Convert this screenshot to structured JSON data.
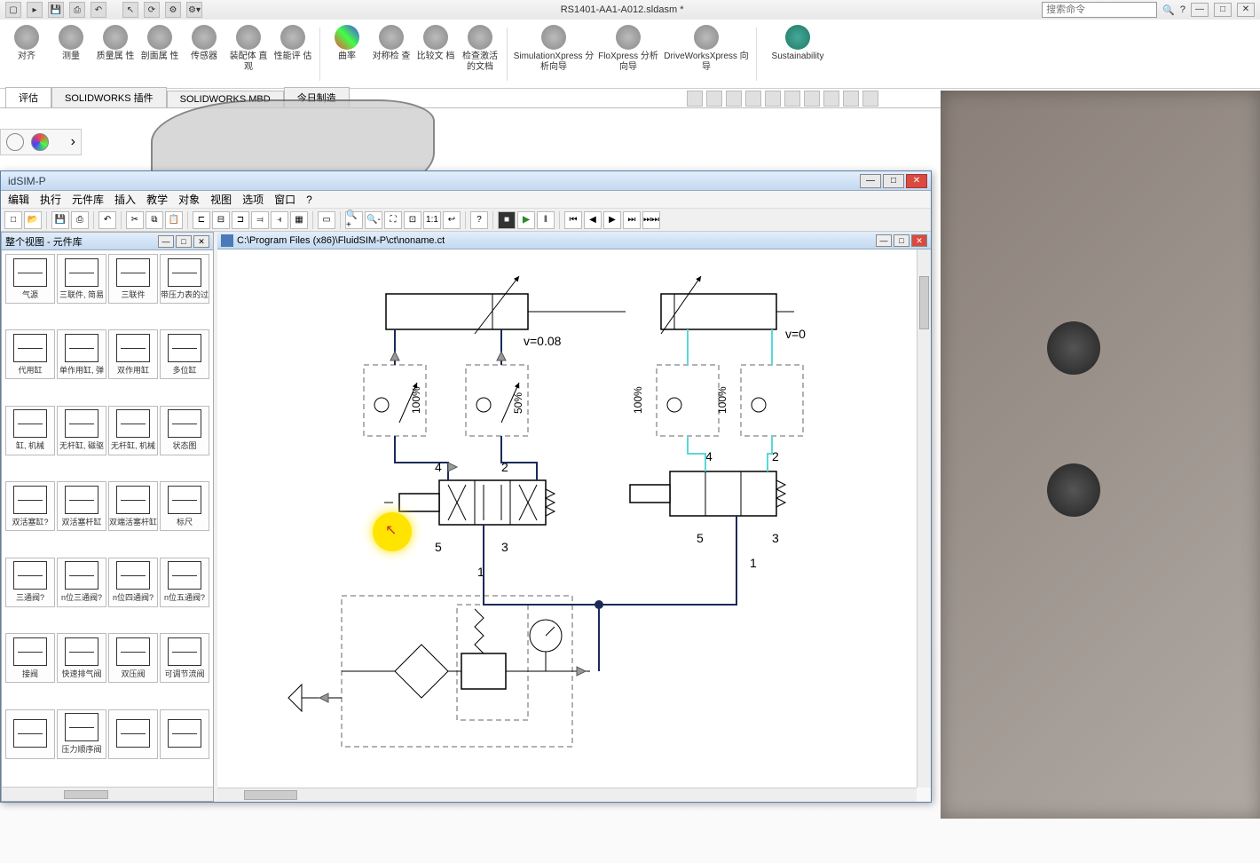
{
  "sw": {
    "title": "RS1401-AA1-A012.sldasm *",
    "search_placeholder": "搜索命令",
    "ribbon": [
      {
        "label": "对齐"
      },
      {
        "label": "测量"
      },
      {
        "label": "质量属\n性"
      },
      {
        "label": "剖面属\n性"
      },
      {
        "label": "传感器"
      },
      {
        "label": "装配体\n直观"
      },
      {
        "label": "性能评\n估"
      },
      {
        "label": "曲率"
      },
      {
        "label": "对称检\n查"
      },
      {
        "label": "比较文\n档"
      },
      {
        "label": "检查激活\n的文档"
      },
      {
        "label": "SimulationXpress\n分析向导"
      },
      {
        "label": "FloXpress\n分析向导"
      },
      {
        "label": "DriveWorksXpress\n向导"
      },
      {
        "label": "Sustainability"
      }
    ],
    "tabs": [
      "评估",
      "SOLIDWORKS 插件",
      "SOLIDWORKS MBD",
      "今日制造"
    ]
  },
  "fs": {
    "title": "idSIM-P",
    "menu": [
      "编辑",
      "执行",
      "元件库",
      "插入",
      "教学",
      "对象",
      "视图",
      "选项",
      "窗口",
      "?"
    ],
    "lib_title": "整个视图 - 元件库",
    "doc_path": "C:\\Program Files (x86)\\FluidSIM-P\\ct\\noname.ct",
    "lib_items": [
      "气源",
      "三联件, 简易",
      "三联件",
      "带压力表的过",
      "代用缸",
      "单作用缸, 弹",
      "双作用缸",
      "多位缸",
      "缸, 机械",
      "无杆缸, 磁驱",
      "无杆缸, 机械",
      "状态图",
      "双活塞缸?",
      "双活塞杆缸",
      "双端活塞杆缸",
      "标尺",
      "三通阀?",
      "n位三通阀?",
      "n位四通阀?",
      "n位五通阀?",
      "接阀",
      "快速排气阀",
      "双压阀",
      "可调节流阀",
      "",
      "压力顺序阀",
      "",
      ""
    ],
    "toolbar_icons": [
      "new",
      "open",
      "save",
      "print",
      "undo",
      "cut",
      "copy",
      "paste",
      "align-l",
      "align-c",
      "align-r",
      "dist-h",
      "dist-v",
      "grid",
      "sel",
      "zoom-in",
      "zoom-out",
      "zoom-fit",
      "zoom-win",
      "zoom-100",
      "zoom-prev",
      "help",
      "stop",
      "play",
      "pause",
      "first",
      "step-back",
      "step",
      "last",
      "end"
    ]
  },
  "circuit": {
    "cyl1_v": "v=0.08",
    "cyl2_v": "v=0",
    "pct100": "100%",
    "pct50": "50%",
    "p4": "4",
    "p2": "2",
    "p5": "5",
    "p3": "3",
    "p1": "1"
  }
}
